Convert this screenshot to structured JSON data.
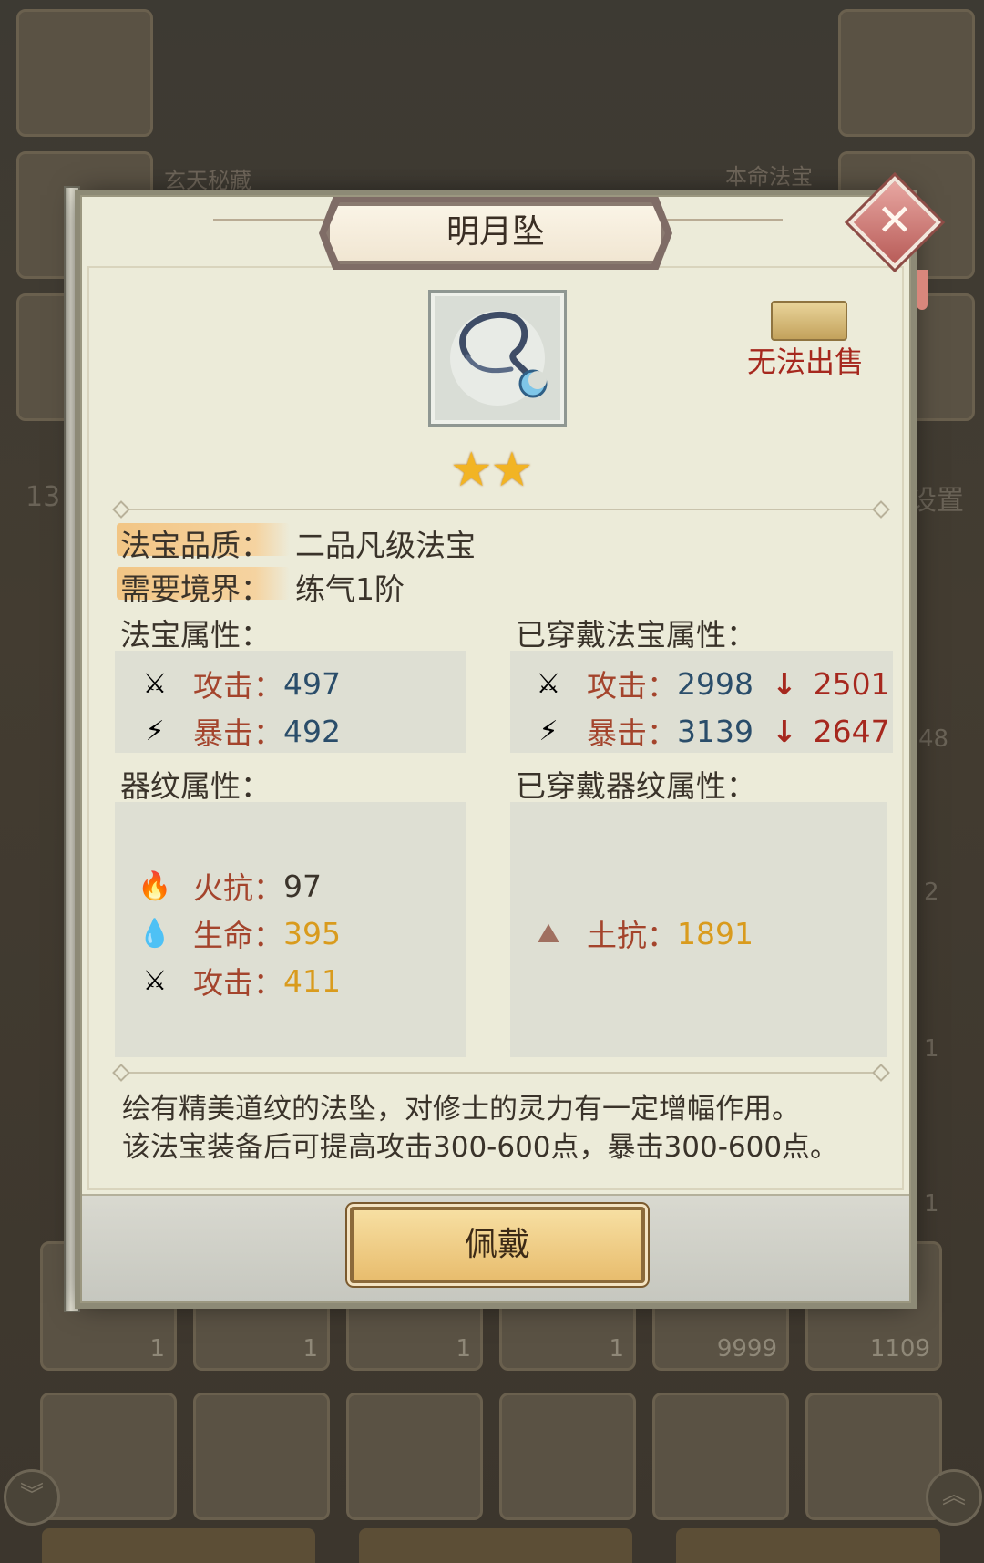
{
  "background": {
    "left_label": "玄天秘藏",
    "right_label": "本命法宝",
    "side_left_number": "13",
    "side_right_text": "设置",
    "slot_counts": [
      "1",
      "1",
      "1",
      "1",
      "9999",
      "1109"
    ],
    "side_counts": [
      "48",
      "2",
      "1",
      "1"
    ]
  },
  "dialog": {
    "title": "明月坠",
    "close_icon": "close-icon",
    "unsellable_label": "无法出售",
    "stars": "★★",
    "quality_label": "法宝品质：",
    "quality_value": "二品凡级法宝",
    "realm_label": "需要境界：",
    "realm_value": "练气1阶",
    "treasure_attr_title": "法宝属性：",
    "worn_attr_title": "已穿戴法宝属性：",
    "treasure_attrs": [
      {
        "icon": "sword-icon",
        "name": "攻击：",
        "value": "497"
      },
      {
        "icon": "crit-icon",
        "name": "暴击：",
        "value": "492"
      }
    ],
    "worn_attrs": [
      {
        "icon": "sword-icon",
        "name": "攻击：",
        "value": "2998",
        "arrow": "↓",
        "diff": "2501"
      },
      {
        "icon": "crit-icon",
        "name": "暴击：",
        "value": "3139",
        "arrow": "↓",
        "diff": "2647"
      }
    ],
    "pattern_attr_title": "器纹属性：",
    "worn_pattern_attr_title": "已穿戴器纹属性：",
    "pattern_attrs": [
      {
        "icon": "fire-icon",
        "name": "火抗：",
        "value": "97"
      },
      {
        "icon": "life-icon",
        "name": "生命：",
        "value": "395"
      },
      {
        "icon": "sword-icon",
        "name": "攻击：",
        "value": "411"
      }
    ],
    "worn_pattern_attrs": [
      {
        "icon": "earth-icon",
        "name": "土抗：",
        "value": "1891"
      }
    ],
    "description_line1": "绘有精美道纹的法坠，对修士的灵力有一定增幅作用。",
    "description_line2": "该法宝装备后可提高攻击300-600点，暴击300-600点。",
    "equip_button": "佩戴"
  },
  "colors": {
    "attr_name": "#a4442c",
    "value_blue": "#2a4d6a",
    "value_gold": "#d99b1d",
    "warning_red": "#a6281e"
  }
}
